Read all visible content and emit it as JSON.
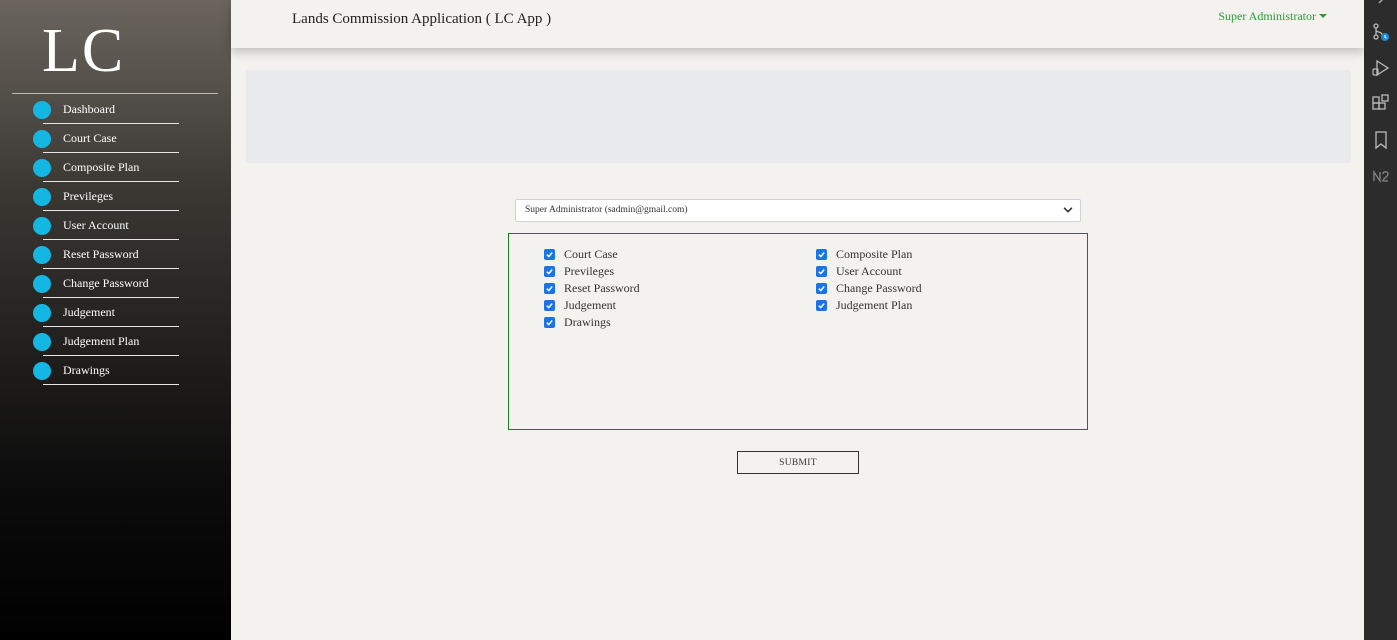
{
  "sidebar": {
    "logo": "LC",
    "items": [
      {
        "label": "Dashboard"
      },
      {
        "label": "Court Case"
      },
      {
        "label": "Composite Plan"
      },
      {
        "label": "Previleges"
      },
      {
        "label": "User Account"
      },
      {
        "label": "Reset Password"
      },
      {
        "label": "Change Password"
      },
      {
        "label": "Judgement"
      },
      {
        "label": "Judgement Plan"
      },
      {
        "label": "Drawings"
      }
    ]
  },
  "header": {
    "title": "Lands Commission Application ( LC App )",
    "user_menu": "Super Administrator"
  },
  "form": {
    "selected_user": "Super Administrator (sadmin@gmail.com)",
    "permissions_left": [
      {
        "label": "Court Case",
        "checked": true
      },
      {
        "label": "Previleges",
        "checked": true
      },
      {
        "label": "Reset Password",
        "checked": true
      },
      {
        "label": "Judgement",
        "checked": true
      },
      {
        "label": "Drawings",
        "checked": true
      }
    ],
    "permissions_right": [
      {
        "label": "Composite Plan",
        "checked": true
      },
      {
        "label": "User Account",
        "checked": true
      },
      {
        "label": "Change Password",
        "checked": true
      },
      {
        "label": "Judgement Plan",
        "checked": true
      }
    ],
    "submit_label": "SUBMIT"
  },
  "activity_bar": {
    "icons": [
      "source-control-icon",
      "run-debug-icon",
      "extensions-icon",
      "bookmark-icon",
      "n2-icon"
    ]
  },
  "colors": {
    "accent_dot": "#13b7e2",
    "user_menu": "#2a9d3a",
    "perm_border": "#1f7a1f",
    "checkbox": "#1a73e8"
  }
}
